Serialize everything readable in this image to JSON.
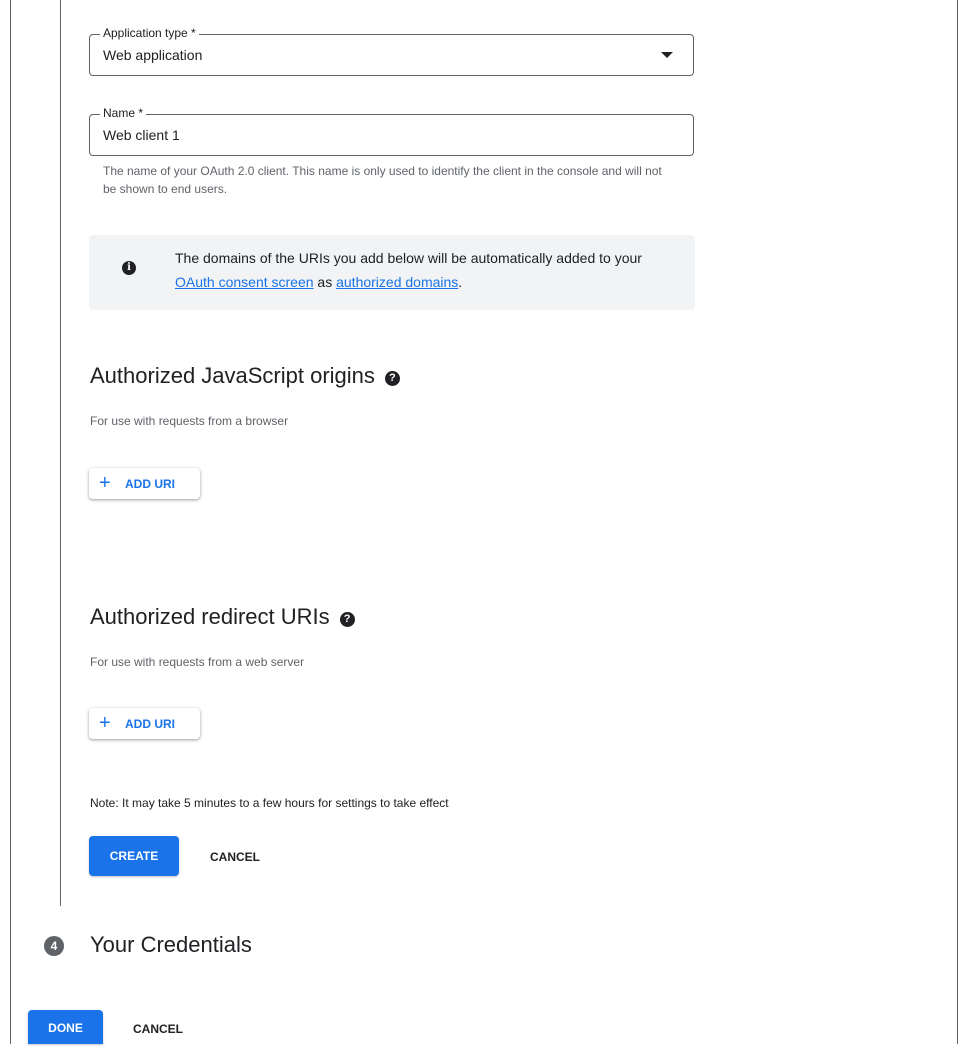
{
  "form": {
    "application_type": {
      "label": "Application type *",
      "value": "Web application"
    },
    "name": {
      "label": "Name *",
      "value": "Web client 1"
    },
    "name_helper": "The name of your OAuth 2.0 client. This name is only used to identify the client in the console and will not be shown to end users."
  },
  "info": {
    "text_before": "The domains of the URIs you add below will be automatically added to your ",
    "link_consent": "OAuth consent screen",
    "text_middle": " as ",
    "link_domains": "authorized domains",
    "text_after": "."
  },
  "js_origins": {
    "title": "Authorized JavaScript origins",
    "subtitle": "For use with requests from a browser",
    "add_label": "ADD URI"
  },
  "redirect_uris": {
    "title": "Authorized redirect URIs",
    "subtitle": "For use with requests from a web server",
    "add_label": "ADD URI"
  },
  "note": "Note: It may take 5 minutes to a few hours for settings to take effect",
  "actions": {
    "create_label": "CREATE",
    "cancel_label": "CANCEL"
  },
  "step4": {
    "number": "4",
    "title": "Your Credentials"
  },
  "footer": {
    "done_label": "DONE",
    "cancel_label": "CANCEL"
  },
  "icons": {
    "info": "info-icon",
    "help": "help-icon",
    "dropdown": "dropdown-arrow-icon",
    "add": "plus-icon"
  },
  "colors": {
    "primary": "#1a73e8",
    "info_bg": "#f1f3f4",
    "step_badge": "#5f6368"
  }
}
